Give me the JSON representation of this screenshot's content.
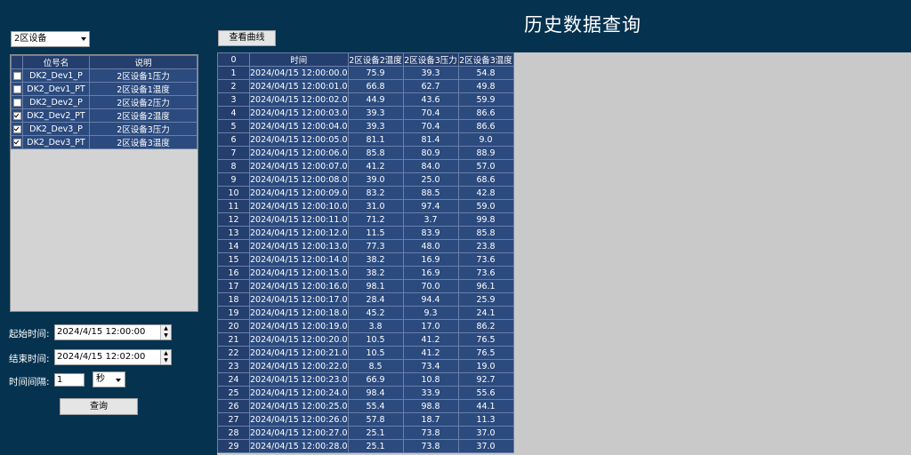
{
  "header": {
    "title": "历史数据查询"
  },
  "region_select": {
    "value": "2区设备"
  },
  "view_curve_button": {
    "label": "查看曲线"
  },
  "point_table": {
    "columns": [
      "位号名",
      "说明"
    ],
    "rows": [
      {
        "checked": false,
        "tag": "DK2_Dev1_P",
        "desc": "2区设备1压力"
      },
      {
        "checked": false,
        "tag": "DK2_Dev1_PT",
        "desc": "2区设备1温度"
      },
      {
        "checked": false,
        "tag": "DK2_Dev2_P",
        "desc": "2区设备2压力"
      },
      {
        "checked": true,
        "tag": "DK2_Dev2_PT",
        "desc": "2区设备2温度"
      },
      {
        "checked": true,
        "tag": "DK2_Dev3_P",
        "desc": "2区设备3压力"
      },
      {
        "checked": true,
        "tag": "DK2_Dev3_PT",
        "desc": "2区设备3温度"
      }
    ]
  },
  "query_form": {
    "start_label": "起始时间:",
    "start_value": "2024/4/15 12:00:00",
    "end_label": "结束时间:",
    "end_value": "2024/4/15 12:02:00",
    "interval_label": "时间间隔:",
    "interval_value": "1",
    "unit_value": "秒",
    "query_label": "查询"
  },
  "data_table": {
    "corner": "0",
    "columns": [
      "时间",
      "2区设备2温度",
      "2区设备3压力",
      "2区设备3温度"
    ],
    "rows": [
      [
        "1",
        "2024/04/15 12:00:00.0",
        "75.9",
        "39.3",
        "54.8"
      ],
      [
        "2",
        "2024/04/15 12:00:01.0",
        "66.8",
        "62.7",
        "49.8"
      ],
      [
        "3",
        "2024/04/15 12:00:02.0",
        "44.9",
        "43.6",
        "59.9"
      ],
      [
        "4",
        "2024/04/15 12:00:03.0",
        "39.3",
        "70.4",
        "86.6"
      ],
      [
        "5",
        "2024/04/15 12:00:04.0",
        "39.3",
        "70.4",
        "86.6"
      ],
      [
        "6",
        "2024/04/15 12:00:05.0",
        "81.1",
        "81.4",
        "9.0"
      ],
      [
        "7",
        "2024/04/15 12:00:06.0",
        "85.8",
        "80.9",
        "88.9"
      ],
      [
        "8",
        "2024/04/15 12:00:07.0",
        "41.2",
        "84.0",
        "57.0"
      ],
      [
        "9",
        "2024/04/15 12:00:08.0",
        "39.0",
        "25.0",
        "68.6"
      ],
      [
        "10",
        "2024/04/15 12:00:09.0",
        "83.2",
        "88.5",
        "42.8"
      ],
      [
        "11",
        "2024/04/15 12:00:10.0",
        "31.0",
        "97.4",
        "59.0"
      ],
      [
        "12",
        "2024/04/15 12:00:11.0",
        "71.2",
        "3.7",
        "99.8"
      ],
      [
        "13",
        "2024/04/15 12:00:12.0",
        "11.5",
        "83.9",
        "85.8"
      ],
      [
        "14",
        "2024/04/15 12:00:13.0",
        "77.3",
        "48.0",
        "23.8"
      ],
      [
        "15",
        "2024/04/15 12:00:14.0",
        "38.2",
        "16.9",
        "73.6"
      ],
      [
        "16",
        "2024/04/15 12:00:15.0",
        "38.2",
        "16.9",
        "73.6"
      ],
      [
        "17",
        "2024/04/15 12:00:16.0",
        "98.1",
        "70.0",
        "96.1"
      ],
      [
        "18",
        "2024/04/15 12:00:17.0",
        "28.4",
        "94.4",
        "25.9"
      ],
      [
        "19",
        "2024/04/15 12:00:18.0",
        "45.2",
        "9.3",
        "24.1"
      ],
      [
        "20",
        "2024/04/15 12:00:19.0",
        "3.8",
        "17.0",
        "86.2"
      ],
      [
        "21",
        "2024/04/15 12:00:20.0",
        "10.5",
        "41.2",
        "76.5"
      ],
      [
        "22",
        "2024/04/15 12:00:21.0",
        "10.5",
        "41.2",
        "76.5"
      ],
      [
        "23",
        "2024/04/15 12:00:22.0",
        "8.5",
        "73.4",
        "19.0"
      ],
      [
        "24",
        "2024/04/15 12:00:23.0",
        "66.9",
        "10.8",
        "92.7"
      ],
      [
        "25",
        "2024/04/15 12:00:24.0",
        "98.4",
        "33.9",
        "55.6"
      ],
      [
        "26",
        "2024/04/15 12:00:25.0",
        "55.4",
        "98.8",
        "44.1"
      ],
      [
        "27",
        "2024/04/15 12:00:26.0",
        "57.8",
        "18.7",
        "11.3"
      ],
      [
        "28",
        "2024/04/15 12:00:27.0",
        "25.1",
        "73.8",
        "37.0"
      ],
      [
        "29",
        "2024/04/15 12:00:28.0",
        "25.1",
        "73.8",
        "37.0"
      ]
    ]
  }
}
